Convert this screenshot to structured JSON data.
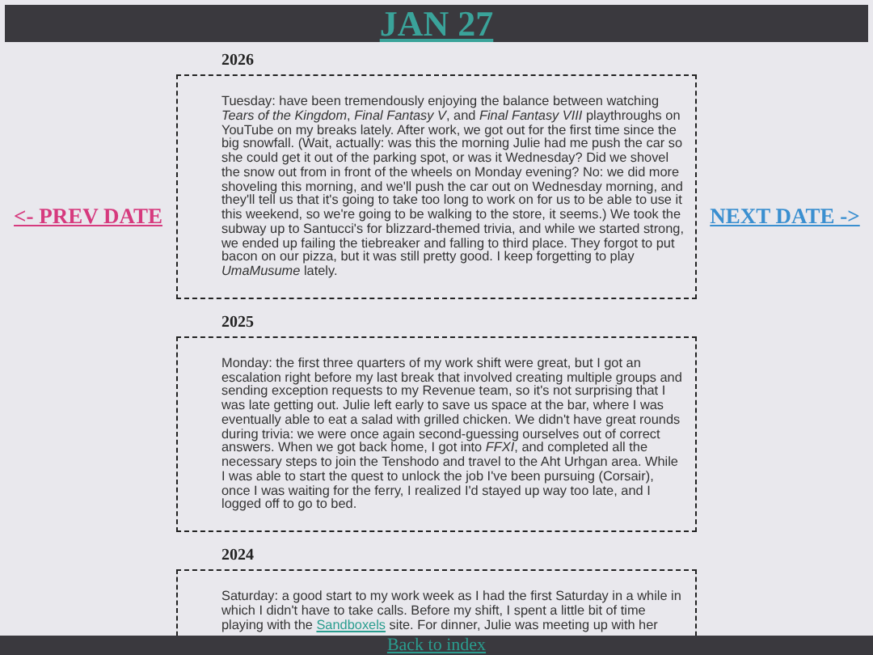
{
  "header": {
    "title": "JAN 27"
  },
  "nav": {
    "prev": "<- PREV DATE",
    "next": "NEXT DATE ->"
  },
  "entries": [
    {
      "year": "2026",
      "parts": [
        {
          "kind": "text",
          "text": "Tuesday: have been tremendously enjoying the balance between watching *Tears of the Kingdom*, *Final Fantasy V*, and *Final Fantasy VIII* playthroughs on YouTube on my breaks lately. After work, we got out for the first time since the big snowfall. (Wait, actually: was this the morning Julie had me push the car so she could get it out of the parking spot, or was it Wednesday? Did we shovel the snow out from in front of the wheels on Monday evening? No: we did more shoveling this morning, and we'll push the car out on Wednesday morning, and they'll tell us that it's going to take too long to work on for us to be able to use it this weekend, so we're going to be walking to the store, it seems.) We took the subway up to Santucci's for blizzard-themed trivia, and while we started strong, we ended up failing the tiebreaker and falling to third place. They forgot to put bacon on our pizza, but it was still pretty good. I keep forgetting to play *UmaMusume* lately."
        }
      ]
    },
    {
      "year": "2025",
      "parts": [
        {
          "kind": "text",
          "text": "Monday: the first three quarters of my work shift were great, but I got an escalation right before my last break that involved creating multiple groups and sending exception requests to my Revenue team, so it's not surprising that I was late getting out. Julie left early to save us space at the bar, where I was eventually able to eat a salad with grilled chicken. We didn't have great rounds during trivia: we were once again second-guessing ourselves out of correct answers. When we got back home, I got into *FFXI*, and completed all the necessary steps to join the Tenshodo and travel to the Aht Urhgan area. While I was able to start the quest to unlock the job I've been pursuing (Corsair), once I was waiting for the ferry, I realized I'd stayed up way too late, and I logged off to go to bed."
        }
      ]
    },
    {
      "year": "2024",
      "parts": [
        {
          "kind": "text",
          "text": "Saturday: a good start to my work week as I had the first Saturday in a while in which I didn't have to take calls. Before my shift, I spent a little bit of time playing with the "
        },
        {
          "kind": "link",
          "text": "Sandboxels"
        },
        {
          "kind": "text",
          "text": " site. For dinner, Julie was meeting up with her"
        }
      ]
    }
  ],
  "footer": {
    "link": "Back to index"
  }
}
